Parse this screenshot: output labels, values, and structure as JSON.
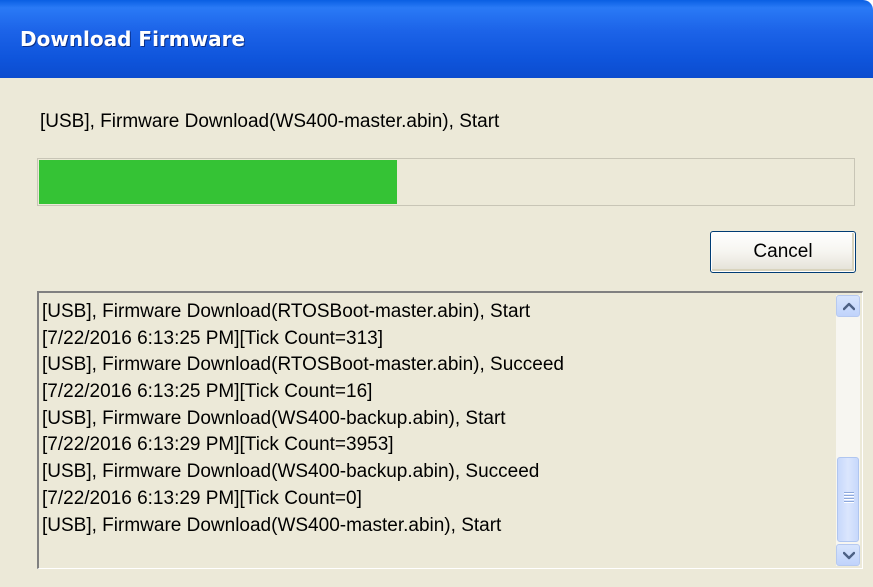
{
  "window": {
    "title": "Download Firmware"
  },
  "status": {
    "text": "[USB], Firmware Download(WS400-master.abin), Start"
  },
  "progress": {
    "percent": 44,
    "color": "#35c335"
  },
  "buttons": {
    "cancel_label": "Cancel"
  },
  "log": {
    "lines": [
      "[USB], Firmware Download(RTOSBoot-master.abin), Start",
      "[7/22/2016 6:13:25 PM][Tick Count=313]",
      "[USB], Firmware Download(RTOSBoot-master.abin), Succeed",
      "[7/22/2016 6:13:25 PM][Tick Count=16]",
      "[USB], Firmware Download(WS400-backup.abin), Start",
      "[7/22/2016 6:13:29 PM][Tick Count=3953]",
      "[USB], Firmware Download(WS400-backup.abin), Succeed",
      "[7/22/2016 6:13:29 PM][Tick Count=0]",
      "[USB], Firmware Download(WS400-master.abin), Start"
    ]
  },
  "icons": {
    "scroll_up": "chevron-up-icon",
    "scroll_down": "chevron-down-icon",
    "thumb_grip": "grip-icon"
  },
  "colors": {
    "titlebar": "#0f55dc",
    "dialog_bg": "#ece9d8"
  }
}
